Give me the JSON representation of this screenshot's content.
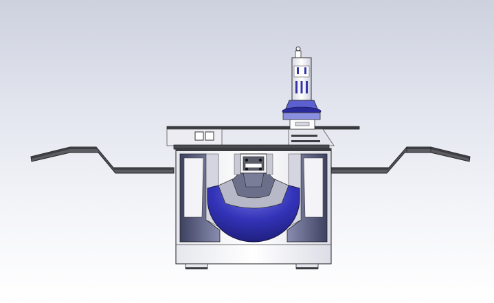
{
  "viewport": {
    "background_top": "#cdd1de",
    "background_bottom": "#ffffff"
  },
  "model": {
    "colors": {
      "outline": "#222222",
      "dark_plate": "#4a4c52",
      "steel_light": "#f2f2f6",
      "steel_mid": "#c8cad6",
      "steel_shadow": "#5f627e",
      "accent_blue": "#2a2a9a",
      "accent_blue_light": "#8b8fe0"
    }
  }
}
